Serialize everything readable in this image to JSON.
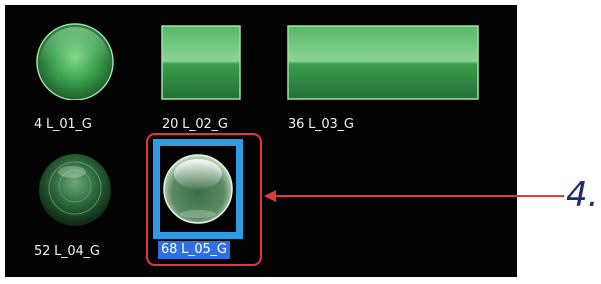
{
  "items": [
    {
      "id": "l01",
      "label": "4 L_01_G",
      "shape": "circle"
    },
    {
      "id": "l02",
      "label": "20 L_02_G",
      "shape": "square"
    },
    {
      "id": "l03",
      "label": "36 L_03_G",
      "shape": "wide-rect"
    },
    {
      "id": "l04",
      "label": "52 L_04_G",
      "shape": "ringed-sphere"
    },
    {
      "id": "l05",
      "label": "68 L_05_G",
      "shape": "glass-sphere",
      "selected": true
    }
  ],
  "callout": {
    "number": "4."
  },
  "colors": {
    "panel_bg": "#030303",
    "selection_blue": "#2f9be0",
    "label_highlight": "#2f6fe0",
    "annotation_red": "#e0393c",
    "callout_text": "#1f2d6e"
  }
}
